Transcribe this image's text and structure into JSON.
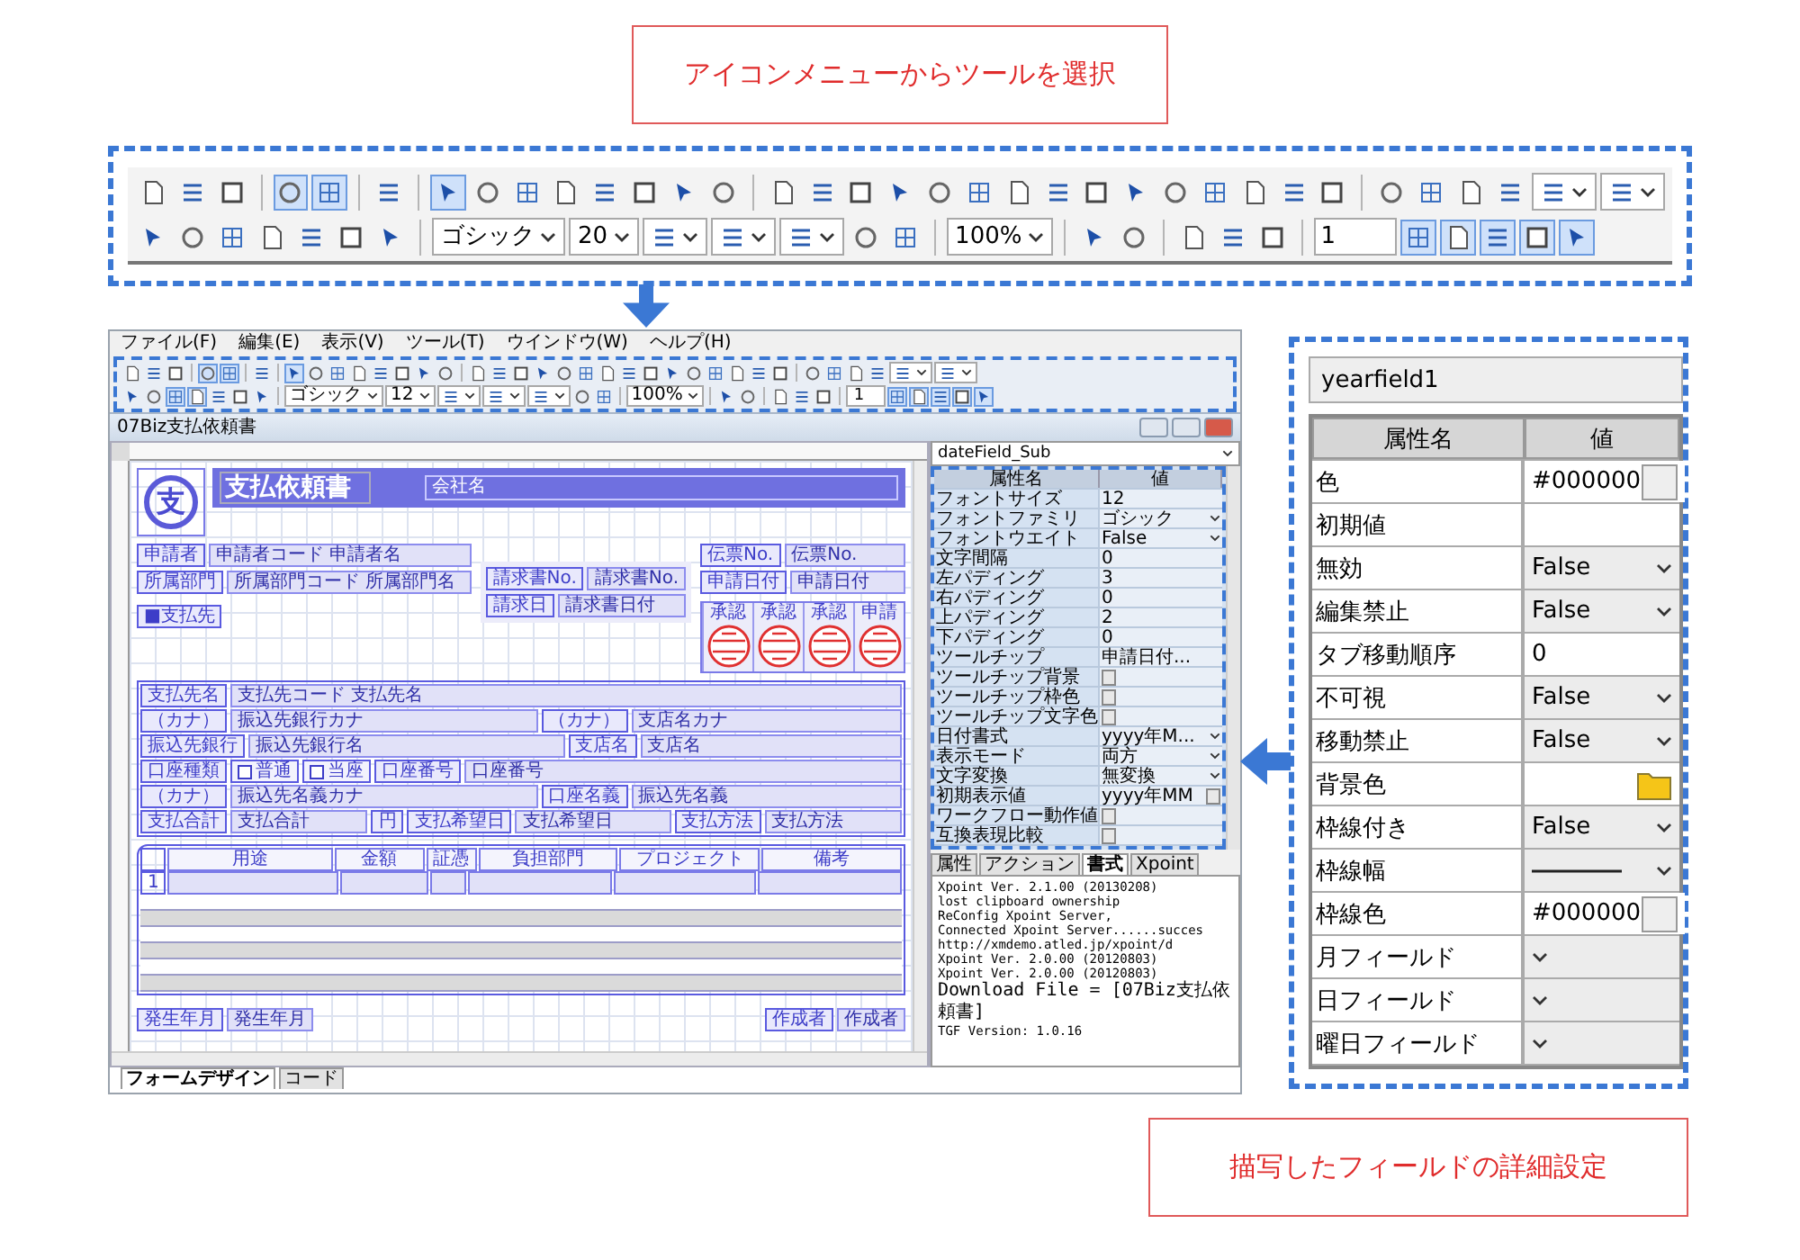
{
  "top_callout": {
    "text": "アイコンメニューからツールを選択"
  },
  "toolbar": {
    "rows": [
      [
        {
          "kind": "button",
          "selected": false
        },
        {
          "kind": "button",
          "selected": false
        },
        {
          "kind": "button",
          "selected": false
        },
        {
          "kind": "separator"
        },
        {
          "kind": "button",
          "selected": true
        },
        {
          "kind": "button",
          "selected": true
        },
        {
          "kind": "separator"
        },
        {
          "kind": "button",
          "selected": false
        },
        {
          "kind": "separator"
        },
        {
          "kind": "button",
          "selected": true
        },
        {
          "kind": "button",
          "selected": false
        },
        {
          "kind": "button",
          "selected": false
        },
        {
          "kind": "button",
          "selected": false
        },
        {
          "kind": "button",
          "selected": false
        },
        {
          "kind": "button",
          "selected": false
        },
        {
          "kind": "button",
          "selected": false
        },
        {
          "kind": "button",
          "selected": false
        },
        {
          "kind": "separator"
        },
        {
          "kind": "button",
          "selected": false
        },
        {
          "kind": "button",
          "selected": false
        },
        {
          "kind": "button",
          "selected": false
        },
        {
          "kind": "button",
          "selected": false
        },
        {
          "kind": "button",
          "selected": false
        },
        {
          "kind": "button",
          "selected": false
        },
        {
          "kind": "button",
          "selected": false
        },
        {
          "kind": "button",
          "selected": false
        },
        {
          "kind": "button",
          "selected": false
        },
        {
          "kind": "button",
          "selected": false
        },
        {
          "kind": "button",
          "selected": false
        },
        {
          "kind": "button",
          "selected": false
        },
        {
          "kind": "button",
          "selected": false
        },
        {
          "kind": "button",
          "selected": false
        },
        {
          "kind": "button",
          "selected": false
        },
        {
          "kind": "separator"
        },
        {
          "kind": "button",
          "selected": false
        },
        {
          "kind": "button",
          "selected": false
        },
        {
          "kind": "button",
          "selected": false
        },
        {
          "kind": "button",
          "selected": false
        },
        {
          "kind": "icon_dropdown"
        },
        {
          "kind": "icon_dropdown"
        }
      ],
      [
        {
          "kind": "button",
          "selected": false
        },
        {
          "kind": "button",
          "selected": false
        },
        {
          "kind": "button",
          "selected": false
        },
        {
          "kind": "button",
          "selected": false
        },
        {
          "kind": "button",
          "selected": false
        },
        {
          "kind": "button",
          "selected": false
        },
        {
          "kind": "button",
          "selected": false
        },
        {
          "kind": "separator"
        },
        {
          "kind": "dropdown",
          "value": "ゴシック"
        },
        {
          "kind": "dropdown",
          "value": "20"
        },
        {
          "kind": "icon_dropdown"
        },
        {
          "kind": "icon_dropdown"
        },
        {
          "kind": "icon_dropdown"
        },
        {
          "kind": "button",
          "selected": false
        },
        {
          "kind": "button",
          "selected": false
        },
        {
          "kind": "separator"
        },
        {
          "kind": "dropdown",
          "value": "100%"
        },
        {
          "kind": "separator"
        },
        {
          "kind": "button",
          "selected": false
        },
        {
          "kind": "button",
          "selected": false
        },
        {
          "kind": "separator"
        },
        {
          "kind": "button",
          "selected": false
        },
        {
          "kind": "button",
          "selected": false
        },
        {
          "kind": "button",
          "selected": false
        },
        {
          "kind": "separator"
        },
        {
          "kind": "input",
          "value": "1"
        },
        {
          "kind": "button",
          "selected": true
        },
        {
          "kind": "button",
          "selected": true
        },
        {
          "kind": "button",
          "selected": true
        },
        {
          "kind": "button",
          "selected": true
        },
        {
          "kind": "button",
          "selected": true
        }
      ]
    ]
  },
  "app": {
    "menu": [
      "ファイル(F)",
      "編集(E)",
      "表示(V)",
      "ツール(T)",
      "ウインドウ(W)",
      "ヘルプ(H)"
    ],
    "toolbar": {
      "rows": [
        [
          {
            "kind": "button",
            "selected": false
          },
          {
            "kind": "button",
            "selected": false
          },
          {
            "kind": "button",
            "selected": false
          },
          {
            "kind": "separator"
          },
          {
            "kind": "button",
            "selected": true
          },
          {
            "kind": "button",
            "selected": true
          },
          {
            "kind": "separator"
          },
          {
            "kind": "button",
            "selected": false
          },
          {
            "kind": "separator"
          },
          {
            "kind": "button",
            "selected": true
          },
          {
            "kind": "button",
            "selected": false
          },
          {
            "kind": "button",
            "selected": false
          },
          {
            "kind": "button",
            "selected": false
          },
          {
            "kind": "button",
            "selected": false
          },
          {
            "kind": "button",
            "selected": false
          },
          {
            "kind": "button",
            "selected": false
          },
          {
            "kind": "button",
            "selected": false
          },
          {
            "kind": "separator"
          },
          {
            "kind": "button",
            "selected": false
          },
          {
            "kind": "button",
            "selected": false
          },
          {
            "kind": "button",
            "selected": false
          },
          {
            "kind": "button",
            "selected": false
          },
          {
            "kind": "button",
            "selected": false
          },
          {
            "kind": "button",
            "selected": false
          },
          {
            "kind": "button",
            "selected": false
          },
          {
            "kind": "button",
            "selected": false
          },
          {
            "kind": "button",
            "selected": false
          },
          {
            "kind": "button",
            "selected": false
          },
          {
            "kind": "button",
            "selected": false
          },
          {
            "kind": "button",
            "selected": false
          },
          {
            "kind": "button",
            "selected": false
          },
          {
            "kind": "button",
            "selected": false
          },
          {
            "kind": "button",
            "selected": false
          },
          {
            "kind": "separator"
          },
          {
            "kind": "button",
            "selected": false
          },
          {
            "kind": "button",
            "selected": false
          },
          {
            "kind": "button",
            "selected": false
          },
          {
            "kind": "button",
            "selected": false
          },
          {
            "kind": "icon_dropdown"
          },
          {
            "kind": "icon_dropdown"
          }
        ],
        [
          {
            "kind": "button",
            "selected": false
          },
          {
            "kind": "button",
            "selected": false
          },
          {
            "kind": "button",
            "selected": true
          },
          {
            "kind": "button",
            "selected": true
          },
          {
            "kind": "button",
            "selected": false
          },
          {
            "kind": "button",
            "selected": false
          },
          {
            "kind": "button",
            "selected": false
          },
          {
            "kind": "separator"
          },
          {
            "kind": "dropdown",
            "value": "ゴシック"
          },
          {
            "kind": "dropdown",
            "value": "12"
          },
          {
            "kind": "icon_dropdown"
          },
          {
            "kind": "icon_dropdown"
          },
          {
            "kind": "icon_dropdown"
          },
          {
            "kind": "button",
            "selected": false
          },
          {
            "kind": "button",
            "selected": false
          },
          {
            "kind": "separator"
          },
          {
            "kind": "dropdown",
            "value": "100%"
          },
          {
            "kind": "separator"
          },
          {
            "kind": "button",
            "selected": false
          },
          {
            "kind": "button",
            "selected": false
          },
          {
            "kind": "separator"
          },
          {
            "kind": "button",
            "selected": false
          },
          {
            "kind": "button",
            "selected": false
          },
          {
            "kind": "button",
            "selected": false
          },
          {
            "kind": "separator"
          },
          {
            "kind": "input",
            "value": "1"
          },
          {
            "kind": "button",
            "selected": true
          },
          {
            "kind": "button",
            "selected": true
          },
          {
            "kind": "button",
            "selected": true
          },
          {
            "kind": "button",
            "selected": true
          },
          {
            "kind": "button",
            "selected": true
          }
        ]
      ]
    },
    "document_title": "07Biz支払依頼書",
    "form": {
      "logo": "支",
      "title": "支払依頼書",
      "company": "会社名",
      "applicant_rows": [
        {
          "label": "申請者",
          "value": "申請者コード 申請者名"
        },
        {
          "label": "所属部門",
          "value": "所属部門コード 所属部門名"
        }
      ],
      "section": "■支払先",
      "invoice_rows": [
        {
          "label": "請求書No.",
          "value": "請求書No."
        },
        {
          "label": "請求日",
          "value": "請求書日付"
        }
      ],
      "slip_rows": [
        {
          "label": "伝票No.",
          "value": "伝票No."
        },
        {
          "label": "申請日付",
          "value": "申請日付"
        }
      ],
      "stamps": [
        {
          "label": "承認"
        },
        {
          "label": "承認"
        },
        {
          "label": "承認"
        },
        {
          "label": "申請"
        }
      ],
      "payee_rows": [
        [
          {
            "kind": "label",
            "text": "支払先名"
          },
          {
            "kind": "value",
            "text": "支払先コード 支払先名"
          }
        ],
        [
          {
            "kind": "label",
            "text": "（カナ）"
          },
          {
            "kind": "value",
            "text": "振込先銀行カナ"
          },
          {
            "kind": "label",
            "text": "（カナ）"
          },
          {
            "kind": "value",
            "text": "支店名カナ"
          }
        ],
        [
          {
            "kind": "label",
            "text": "振込先銀行"
          },
          {
            "kind": "value",
            "text": "振込先銀行名"
          },
          {
            "kind": "label",
            "text": "支店名"
          },
          {
            "kind": "value",
            "text": "支店名"
          }
        ],
        [
          {
            "kind": "label",
            "text": "口座種類"
          },
          {
            "kind": "check",
            "text": "普通",
            "checked": false
          },
          {
            "kind": "check",
            "text": "当座",
            "checked": false
          },
          {
            "kind": "label",
            "text": "口座番号"
          },
          {
            "kind": "value",
            "text": "口座番号"
          }
        ],
        [
          {
            "kind": "label",
            "text": "（カナ）"
          },
          {
            "kind": "value",
            "text": "振込先名義カナ"
          },
          {
            "kind": "label",
            "text": "口座名義"
          },
          {
            "kind": "value",
            "text": "振込先名義"
          }
        ],
        [
          {
            "kind": "label",
            "text": "支払合計"
          },
          {
            "kind": "value",
            "text": "支払合計"
          },
          {
            "kind": "label",
            "text": "円"
          },
          {
            "kind": "label",
            "text": "支払希望日"
          },
          {
            "kind": "value",
            "text": "支払希望日"
          },
          {
            "kind": "label",
            "text": "支払方法"
          },
          {
            "kind": "value",
            "text": "支払方法"
          }
        ]
      ],
      "table": {
        "columns": [
          "用途",
          "金額",
          "証憑",
          "負担部門",
          "プロジェクト",
          "備考"
        ],
        "row_number": "1"
      },
      "footer": [
        {
          "label": "発生年月",
          "value": "発生年月"
        },
        {
          "label": "作成者",
          "value": "作成者"
        }
      ]
    },
    "properties": {
      "object": "dateField_Sub",
      "columns": [
        "属性名",
        "値"
      ],
      "rows": [
        {
          "name": "フォントサイズ",
          "kind": "text",
          "value": "12"
        },
        {
          "name": "フォントファミリ",
          "kind": "select",
          "value": "ゴシック"
        },
        {
          "name": "フォントウエイト",
          "kind": "select",
          "value": "False"
        },
        {
          "name": "文字間隔",
          "kind": "text",
          "value": "0"
        },
        {
          "name": "左パディング",
          "kind": "text",
          "value": "3"
        },
        {
          "name": "右パディング",
          "kind": "text",
          "value": "0"
        },
        {
          "name": "上パディング",
          "kind": "text",
          "value": "2"
        },
        {
          "name": "下パディング",
          "kind": "text",
          "value": "0"
        },
        {
          "name": "ツールチップ",
          "kind": "text",
          "value": "申請日付..."
        },
        {
          "name": "ツールチップ背景",
          "kind": "button"
        },
        {
          "name": "ツールチップ枠色",
          "kind": "button"
        },
        {
          "name": "ツールチップ文字色",
          "kind": "button"
        },
        {
          "name": "日付書式",
          "kind": "select",
          "value": "yyyy年M..."
        },
        {
          "name": "表示モード",
          "kind": "select",
          "value": "両方"
        },
        {
          "name": "文字変換",
          "kind": "select",
          "value": "無変換"
        },
        {
          "name": "初期表示値",
          "kind": "button",
          "value": "yyyy年MM"
        },
        {
          "name": "ワークフロー動作値",
          "kind": "button"
        },
        {
          "name": "互換表現比較",
          "kind": "button"
        }
      ]
    },
    "panel_tabs": [
      {
        "label": "属性",
        "selected": false
      },
      {
        "label": "アクション",
        "selected": false
      },
      {
        "label": "書式",
        "selected": true
      },
      {
        "label": "Xpoint",
        "selected": false
      }
    ],
    "log": [
      "Xpoint Ver. 2.1.00 (20130208)",
      "lost clipboard ownership",
      "ReConfig Xpoint Server,",
      "Connected Xpoint Server......succes",
      "http://xmdemo.atled.jp/xpoint/d",
      "Xpoint Ver. 2.0.00 (20120803)",
      "Xpoint Ver. 2.0.00 (20120803)",
      "Download File = [07Biz支払依頼書]",
      "TGF Version: 1.0.16"
    ],
    "bottom_tabs": [
      {
        "label": "フォームデザイン",
        "selected": true
      },
      {
        "label": "コード",
        "selected": false
      }
    ]
  },
  "detail_panel": {
    "object": "yearfield1",
    "columns": [
      "属性名",
      "値"
    ],
    "rows": [
      {
        "name": "色",
        "kind": "color",
        "value": "#000000"
      },
      {
        "name": "初期値",
        "kind": "text"
      },
      {
        "name": "無効",
        "kind": "select",
        "value": "False"
      },
      {
        "name": "編集禁止",
        "kind": "select",
        "value": "False"
      },
      {
        "name": "タブ移動順序",
        "kind": "text",
        "value": "0"
      },
      {
        "name": "不可視",
        "kind": "select",
        "value": "False"
      },
      {
        "name": "移動禁止",
        "kind": "select",
        "value": "False"
      },
      {
        "name": "背景色",
        "kind": "fill"
      },
      {
        "name": "枠線付き",
        "kind": "select",
        "value": "False"
      },
      {
        "name": "枠線幅",
        "kind": "line"
      },
      {
        "name": "枠線色",
        "kind": "color",
        "value": "#000000"
      },
      {
        "name": "月フィールド",
        "kind": "select"
      },
      {
        "name": "日フィールド",
        "kind": "select"
      },
      {
        "name": "曜日フィールド",
        "kind": "select"
      }
    ]
  },
  "bottom_callout": {
    "text": "描写したフィールドの詳細設定"
  }
}
